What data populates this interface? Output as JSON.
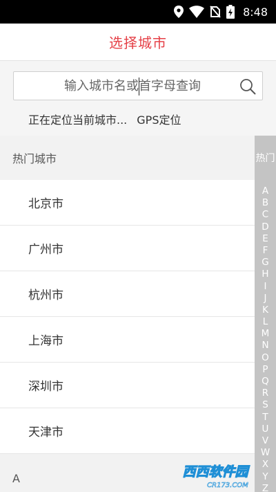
{
  "status_bar": {
    "time": "8:48",
    "icons": [
      "location-icon",
      "wifi-icon",
      "no-sim-icon",
      "battery-charging-icon"
    ]
  },
  "header": {
    "title": "选择城市"
  },
  "search": {
    "placeholder": "输入城市名或首字母查询",
    "icon": "search-icon"
  },
  "location": {
    "status": "正在定位当前城市...",
    "gps_label": "GPS定位"
  },
  "hot_section": {
    "title": "热门城市",
    "cities": [
      "北京市",
      "广州市",
      "杭州市",
      "上海市",
      "深圳市",
      "天津市"
    ]
  },
  "section_a": {
    "title": "A"
  },
  "index_bar": {
    "hot_label": "热门",
    "letters": [
      "A",
      "B",
      "C",
      "D",
      "E",
      "F",
      "G",
      "H",
      "I",
      "J",
      "K",
      "L",
      "M",
      "N",
      "O",
      "P",
      "Q",
      "R",
      "S",
      "T",
      "U",
      "V",
      "W",
      "X",
      "Y",
      "Z"
    ]
  },
  "watermark": {
    "text": "西西软件园",
    "sub": "CR173.COM"
  },
  "colors": {
    "accent": "#e53f46",
    "index_bar_bg": "#c4c4c4",
    "section_bg": "#f2f2f2"
  }
}
